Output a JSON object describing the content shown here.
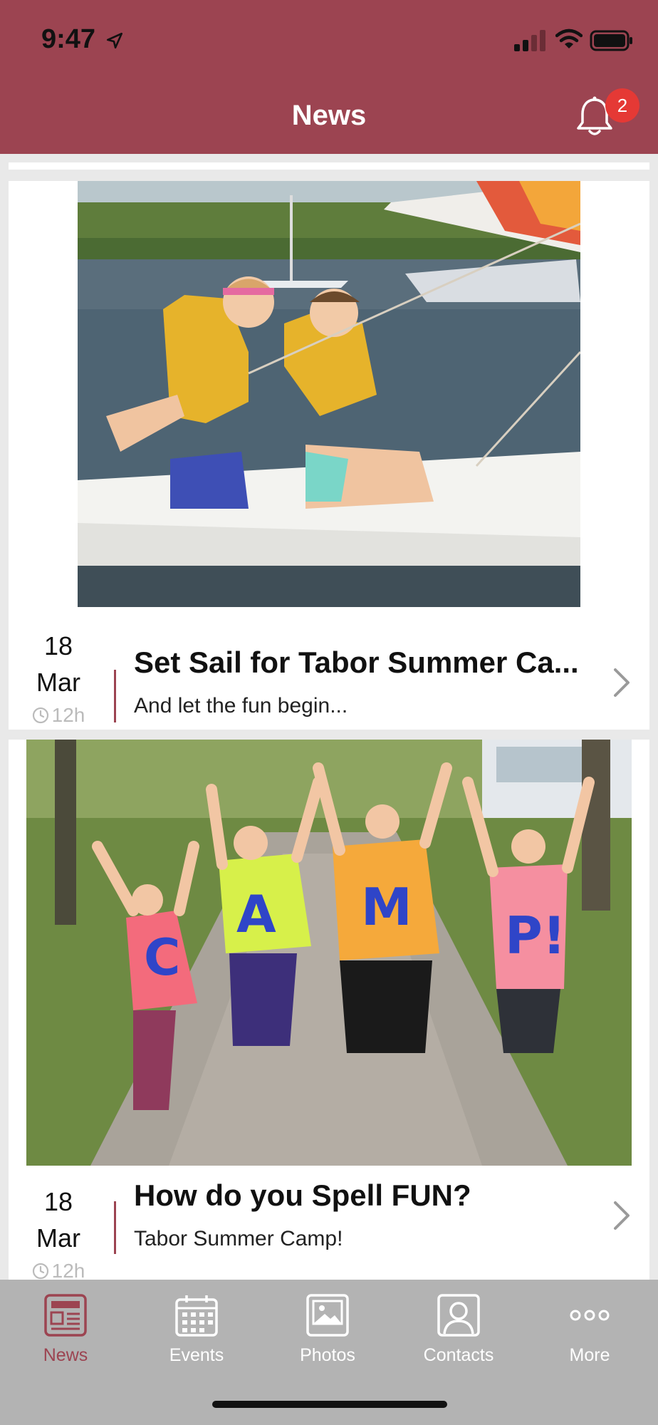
{
  "status_bar": {
    "time": "9:47"
  },
  "header": {
    "title": "News",
    "notification_count": "2"
  },
  "news": [
    {
      "day": "18",
      "month": "Mar",
      "age": "12h",
      "title": "Set Sail for Tabor Summer Ca...",
      "subtitle": "And let the fun begin...",
      "image": "sailboat-photo"
    },
    {
      "day": "18",
      "month": "Mar",
      "age": "12h",
      "title": "How do you Spell FUN?",
      "subtitle": "Tabor Summer Camp!",
      "image": "camp-photo"
    }
  ],
  "tabbar": {
    "items": [
      {
        "label": "News",
        "icon": "newspaper-icon",
        "active": true
      },
      {
        "label": "Events",
        "icon": "calendar-icon",
        "active": false
      },
      {
        "label": "Photos",
        "icon": "photo-icon",
        "active": false
      },
      {
        "label": "Contacts",
        "icon": "contact-icon",
        "active": false
      },
      {
        "label": "More",
        "icon": "more-icon",
        "active": false
      }
    ]
  },
  "colors": {
    "brand": "#9c4451",
    "badge": "#e53935",
    "tabbar": "#b3b3b3"
  }
}
